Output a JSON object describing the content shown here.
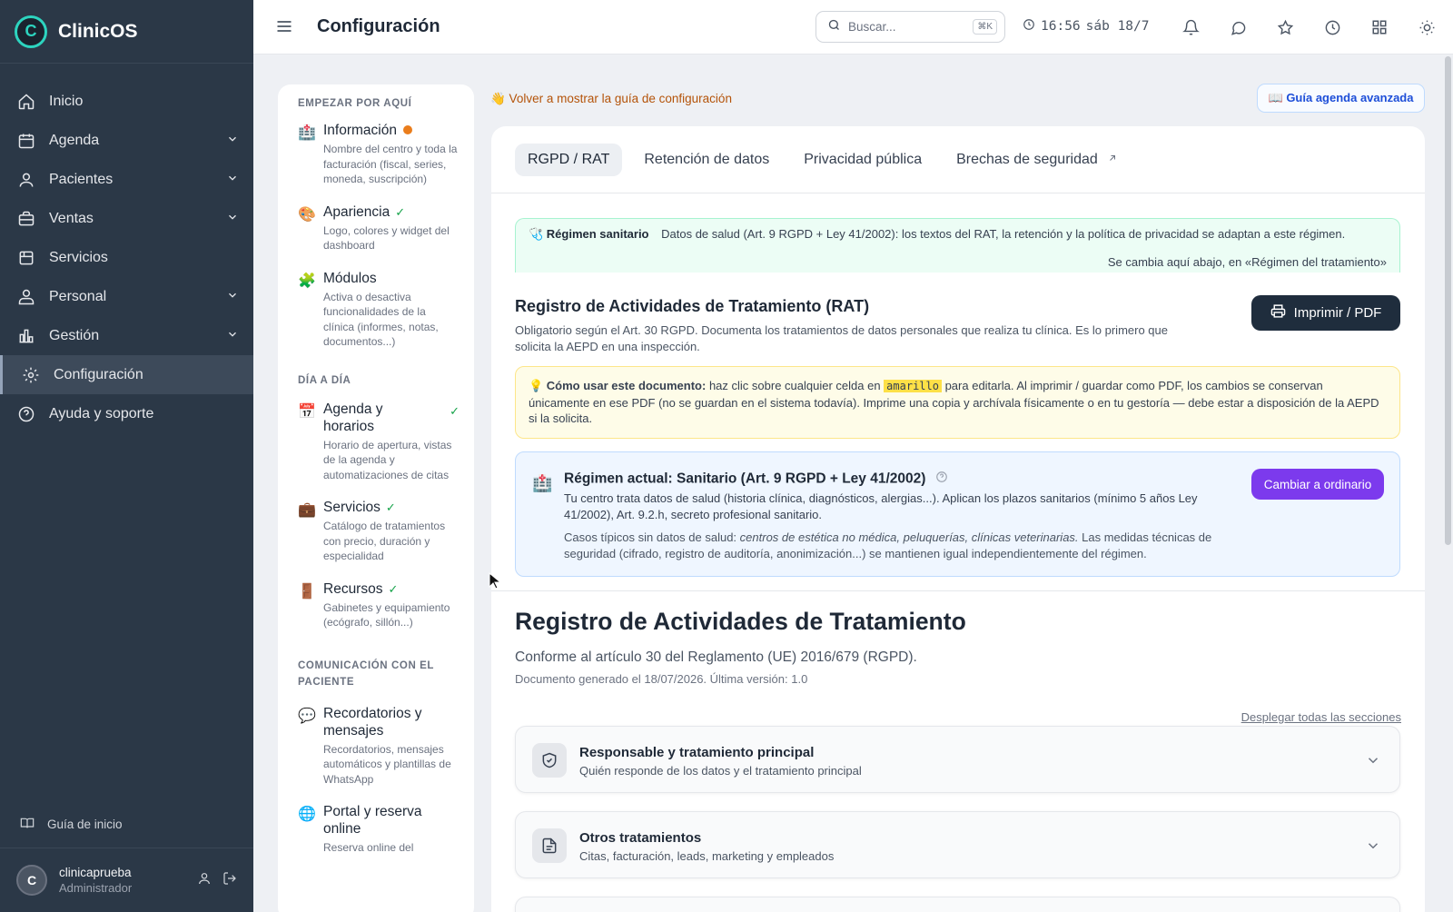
{
  "app": {
    "name": "ClinicOS",
    "logo_letter": "C"
  },
  "sidebar": {
    "items": [
      {
        "label": "Inicio",
        "icon": "home-icon",
        "has_chevron": false
      },
      {
        "label": "Agenda",
        "icon": "calendar-icon",
        "has_chevron": true
      },
      {
        "label": "Pacientes",
        "icon": "users-icon",
        "has_chevron": true
      },
      {
        "label": "Ventas",
        "icon": "briefcase-icon",
        "has_chevron": true
      },
      {
        "label": "Servicios",
        "icon": "box-icon",
        "has_chevron": false
      },
      {
        "label": "Personal",
        "icon": "staff-icon",
        "has_chevron": true
      },
      {
        "label": "Gestión",
        "icon": "chart-icon",
        "has_chevron": true
      },
      {
        "label": "Configuración",
        "icon": "gear-icon",
        "has_chevron": false,
        "active": true
      },
      {
        "label": "Ayuda y soporte",
        "icon": "help-icon",
        "has_chevron": false
      }
    ],
    "guide_label": "Guía de inicio",
    "user": {
      "initial": "C",
      "name": "clinicaprueba",
      "role": "Administrador"
    }
  },
  "topbar": {
    "title": "Configuración",
    "search_placeholder": "Buscar...",
    "search_shortcut": "⌘K",
    "time": "16:56",
    "date": "sáb 18/7"
  },
  "settings_nav": {
    "sections": [
      {
        "title": "EMPEZAR POR AQUÍ",
        "items": [
          {
            "icon": "🏥",
            "title": "Información",
            "status": "dot",
            "desc": "Nombre del centro y toda la facturación (fiscal, series, moneda, suscripción)"
          },
          {
            "icon": "🎨",
            "title": "Apariencia",
            "status": "check",
            "desc": "Logo, colores y widget del dashboard"
          },
          {
            "icon": "🧩",
            "title": "Módulos",
            "status": "",
            "desc": "Activa o desactiva funcionalidades de la clínica (informes, notas, documentos...)"
          }
        ]
      },
      {
        "title": "DÍA A DÍA",
        "items": [
          {
            "icon": "📅",
            "title": "Agenda y horarios",
            "status": "check-right",
            "desc": "Horario de apertura, vistas de la agenda y automatizaciones de citas"
          },
          {
            "icon": "💼",
            "title": "Servicios",
            "status": "check",
            "desc": "Catálogo de tratamientos con precio, duración y especialidad"
          },
          {
            "icon": "🚪",
            "title": "Recursos",
            "status": "check",
            "desc": "Gabinetes y equipamiento (ecógrafo, sillón...)"
          }
        ]
      },
      {
        "title": "COMUNICACIÓN CON EL PACIENTE",
        "items": [
          {
            "icon": "💬",
            "title": "Recordatorios y mensajes",
            "status": "",
            "desc": "Recordatorios, mensajes automáticos y plantillas de WhatsApp"
          },
          {
            "icon": "🌐",
            "title": "Portal y reserva online",
            "status": "",
            "desc": "Reserva online del"
          }
        ]
      }
    ]
  },
  "main": {
    "guide_link": "👋 Volver a mostrar la guía de configuración",
    "guide_button": "📖 Guía agenda avanzada",
    "tabs": [
      {
        "label": "RGPD / RAT",
        "active": true
      },
      {
        "label": "Retención de datos",
        "active": false
      },
      {
        "label": "Privacidad pública",
        "active": false
      },
      {
        "label": "Brechas de seguridad",
        "active": false,
        "external": true
      }
    ],
    "regime_banner": {
      "label": "🩺 Régimen sanitario",
      "text": "Datos de salud (Art. 9 RGPD + Ley 41/2002): los textos del RAT, la retención y la política de privacidad se adaptan a este régimen.",
      "sub": "Se cambia aquí abajo, en «Régimen del tratamiento»"
    },
    "rat": {
      "title": "Registro de Actividades de Tratamiento (RAT)",
      "desc": "Obligatorio según el Art. 30 RGPD. Documenta los tratamientos de datos personales que realiza tu clínica. Es lo primero que solicita la AEPD en una inspección.",
      "print_button": "Imprimir / PDF"
    },
    "howto": {
      "bold": "💡 Cómo usar este documento:",
      "pre": " haz clic sobre cualquier celda en ",
      "highlight": "amarillo",
      "post": " para editarla. Al imprimir / guardar como PDF, los cambios se conservan únicamente en ese PDF (no se guardan en el sistema todavía). Imprime una copia y archívala físicamente o en tu gestoría — debe estar a disposición de la AEPD si la solicita."
    },
    "regime_box": {
      "icon": "🏥",
      "title": "Régimen actual: Sanitario (Art. 9 RGPD + Ley 41/2002)",
      "line1": "Tu centro trata datos de salud (historia clínica, diagnósticos, alergias...). Aplican los plazos sanitarios (mínimo 5 años Ley 41/2002), Art. 9.2.h, secreto profesional sanitario.",
      "line2_pre": "Casos típicos sin datos de salud: ",
      "line2_em": "centros de estética no médica, peluquerías, clínicas veterinarias.",
      "line2_post": " Las medidas técnicas de seguridad (cifrado, registro de auditoría, anonimización...) se mantienen igual independientemente del régimen.",
      "button": "Cambiar a ordinario"
    },
    "document": {
      "title": "Registro de Actividades de Tratamiento",
      "subtitle": "Conforme al artículo 30 del Reglamento (UE) 2016/679 (RGPD).",
      "meta": "Documento generado el 18/07/2026. Última versión: 1.0",
      "expand_all": "Desplegar todas las secciones"
    },
    "accordions": [
      {
        "icon": "shield-check-icon",
        "title": "Responsable y tratamiento principal",
        "desc": "Quién responde de los datos y el tratamiento principal"
      },
      {
        "icon": "document-icon",
        "title": "Otros tratamientos",
        "desc": "Citas, facturación, leads, marketing y empleados"
      }
    ]
  },
  "colors": {
    "sidebar_bg": "#2b3847",
    "accent_teal": "#2dd4bf",
    "primary_dark": "#1f2d3d",
    "purple": "#7c3aed",
    "warning_orange": "#ea7d1c",
    "success_green": "#16a34a"
  }
}
